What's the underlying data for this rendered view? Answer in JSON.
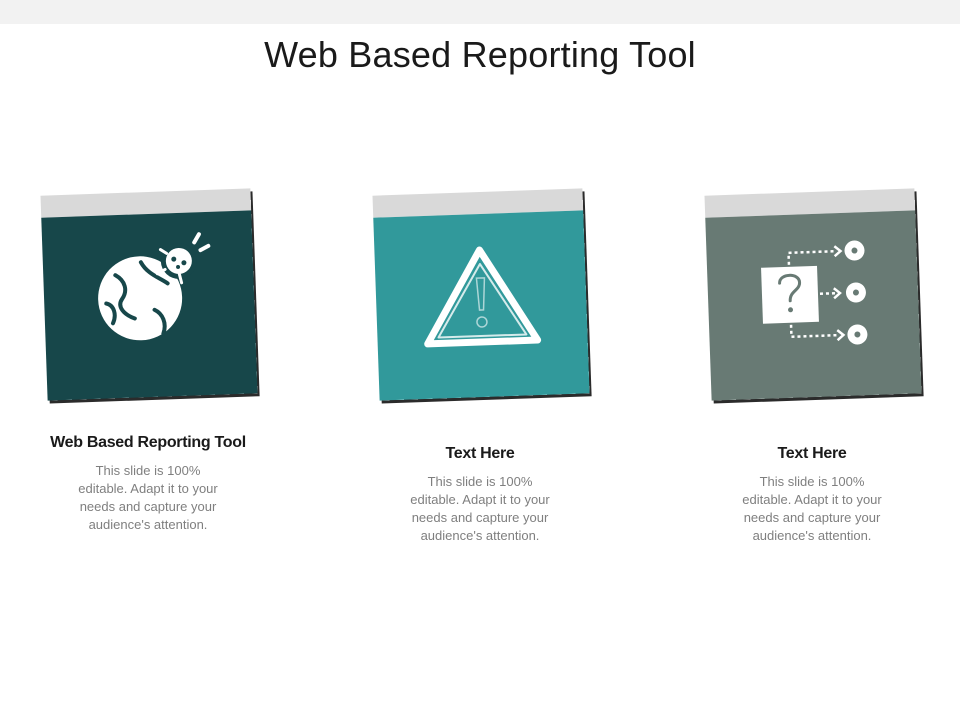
{
  "slide": {
    "title": "Web Based Reporting Tool"
  },
  "cards": [
    {
      "icon": "globe-virus-icon",
      "heading": "Web Based Reporting Tool",
      "body": "This slide is 100% editable. Adapt it to your needs and capture your audience's attention.",
      "color": "#17474a"
    },
    {
      "icon": "warning-triangle-icon",
      "heading": "Text Here",
      "body": "This slide is 100% editable. Adapt it to your needs and capture your audience's attention.",
      "color": "#31999b"
    },
    {
      "icon": "question-flow-icon",
      "heading": "Text Here",
      "body": "This slide is 100% editable. Adapt it to your needs and capture your audience's attention.",
      "color": "#687a74"
    }
  ],
  "colors": {
    "tab": "#d9d9d9",
    "shadow": "#2b2b2b",
    "title_text": "#1a1a1a",
    "body_text": "#7f7f7f"
  }
}
